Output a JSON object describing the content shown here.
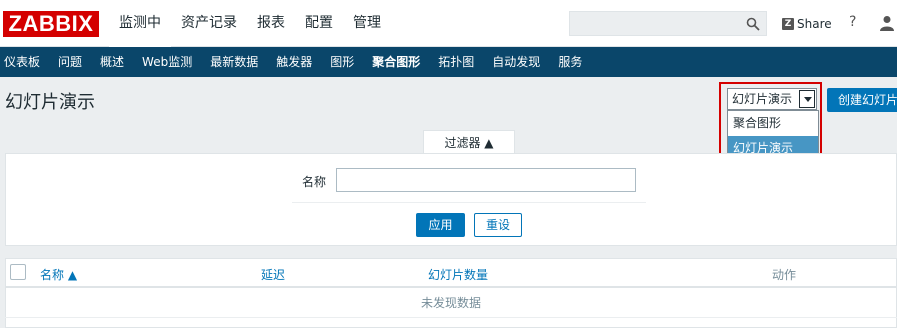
{
  "header": {
    "logo_text": "ZABBIX",
    "main_menu": [
      "监测中",
      "资产记录",
      "报表",
      "配置",
      "管理"
    ],
    "search_placeholder": "",
    "share_label": "Share",
    "help_label": "?"
  },
  "submenu": [
    "仪表板",
    "问题",
    "概述",
    "Web监测",
    "最新数据",
    "触发器",
    "图形",
    "聚合图形",
    "拓扑图",
    "自动发现",
    "服务"
  ],
  "page": {
    "title": "幻灯片演示",
    "view_select_value": "幻灯片演示",
    "view_options": [
      "聚合图形",
      "幻灯片演示"
    ],
    "create_button": "创建幻灯片"
  },
  "filter": {
    "tab_label": "过滤器 ▲",
    "name_label": "名称",
    "name_value": "",
    "apply_label": "应用",
    "reset_label": "重设"
  },
  "table": {
    "columns": [
      "名称 ▲",
      "延迟",
      "幻灯片数量",
      "动作"
    ],
    "empty_text": "未发现数据"
  },
  "colors": {
    "brand_red": "#d40000",
    "nav_blue": "#0a466a",
    "primary": "#0275b8",
    "selected_option": "#4796c4"
  }
}
